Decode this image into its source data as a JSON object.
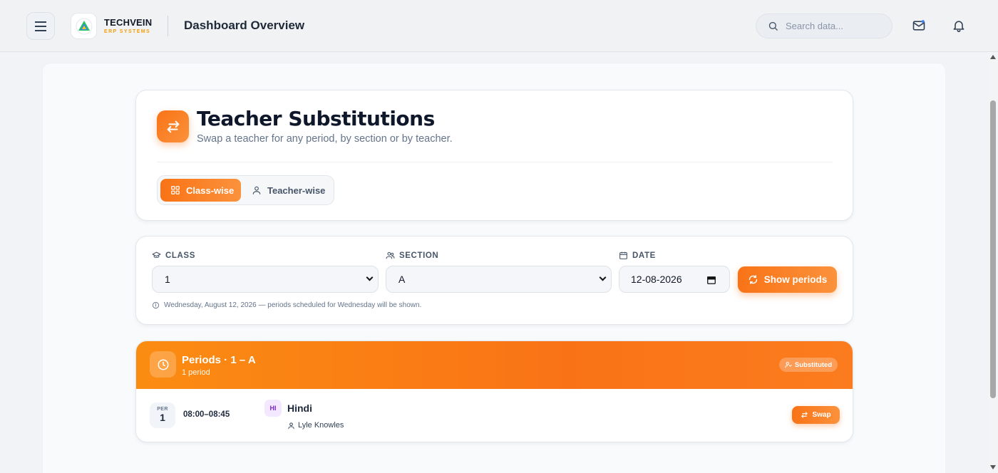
{
  "header": {
    "brand_name": "TECHVEIN",
    "brand_tagline": "ERP SYSTEMS",
    "page_title": "Dashboard Overview",
    "search_placeholder": "Search data...",
    "icons": [
      "menu-icon",
      "search-icon",
      "mail-icon",
      "bell-icon"
    ]
  },
  "page": {
    "title": "Teacher Substitutions",
    "subtitle": "Swap a teacher for any period, by section or by teacher.",
    "modes": [
      {
        "label": "Class-wise",
        "icon": "grid-icon",
        "active": true
      },
      {
        "label": "Teacher-wise",
        "icon": "user-icon",
        "active": false
      }
    ]
  },
  "filters": {
    "class_label": "CLASS",
    "class_value": "1",
    "section_label": "SECTION",
    "section_value": "A",
    "date_label": "DATE",
    "date_value": "12-08-2026",
    "show_button": "Show periods",
    "info": "Wednesday, August 12, 2026 — periods scheduled for Wednesday will be shown."
  },
  "periods": {
    "title": "Periods · 1 – A",
    "count": "1 period",
    "badge": "Substituted",
    "rows": [
      {
        "per_label": "PER",
        "per_number": "1",
        "time": "08:00–08:45",
        "subject_abbr": "HI",
        "subject": "Hindi",
        "teacher": "Lyle Knowles",
        "action": "Swap"
      }
    ]
  },
  "colors": {
    "accent": "#f97316",
    "accent_light": "#fb923c",
    "subject_badge_bg": "#f3e8ff",
    "subject_badge_text": "#7e22ce"
  }
}
